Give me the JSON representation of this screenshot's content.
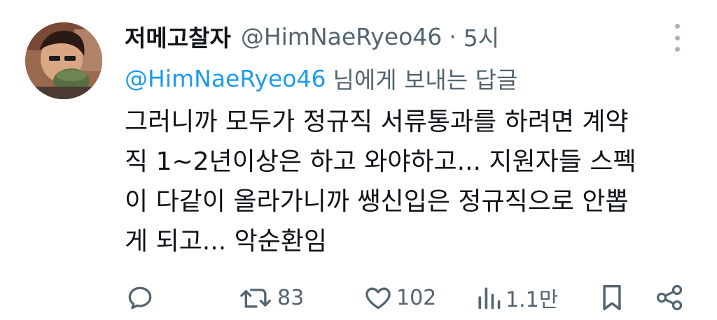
{
  "tweet": {
    "display_name": "저메고찰자",
    "handle": "@HimNaeRyeo46",
    "separator": "·",
    "time": "5시",
    "reply_to": {
      "handle": "@HimNaeRyeo46",
      "suffix": "님에게 보내는 답글"
    },
    "body_lines": [
      "그러니까 모두가 정규직 서류통과를 하려면 계약",
      "직 1~2년이상은 하고 와야하고... 지원자들 스펙",
      "이 다같이 올라가니까 쌩신입은 정규직으로 안뽑",
      "게 되고... 악순환임"
    ],
    "stats": {
      "retweets": "83",
      "likes": "102",
      "views": "1.1만"
    }
  },
  "icons": {
    "reply": "reply-icon",
    "retweet": "retweet-icon",
    "like": "heart-icon",
    "views": "views-icon",
    "bookmark": "bookmark-icon",
    "share": "share-icon",
    "more": "more-icon"
  },
  "colors": {
    "text": "#0f1419",
    "secondary": "#536471",
    "link": "#1d9bf0",
    "background": "#ffffff"
  }
}
